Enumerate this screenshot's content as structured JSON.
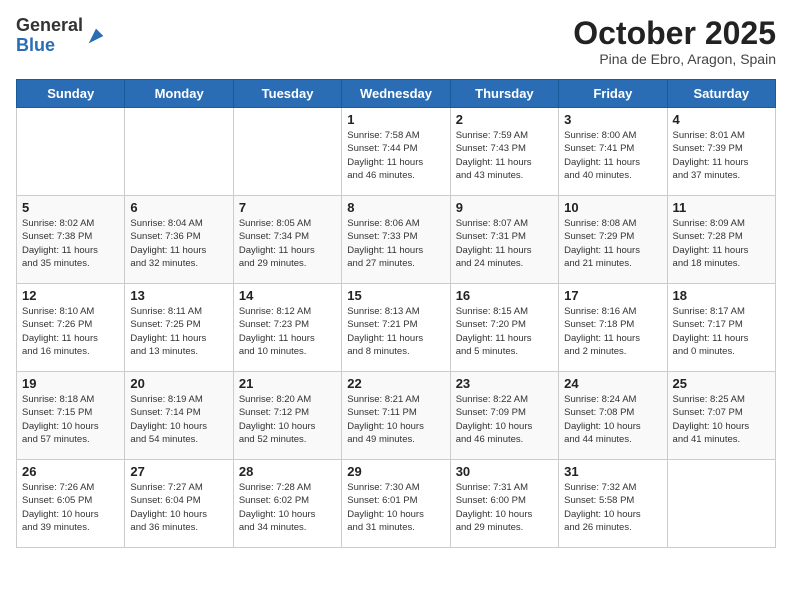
{
  "header": {
    "logo_line1": "General",
    "logo_line2": "Blue",
    "month": "October 2025",
    "location": "Pina de Ebro, Aragon, Spain"
  },
  "weekdays": [
    "Sunday",
    "Monday",
    "Tuesday",
    "Wednesday",
    "Thursday",
    "Friday",
    "Saturday"
  ],
  "weeks": [
    [
      {
        "day": "",
        "info": ""
      },
      {
        "day": "",
        "info": ""
      },
      {
        "day": "",
        "info": ""
      },
      {
        "day": "1",
        "info": "Sunrise: 7:58 AM\nSunset: 7:44 PM\nDaylight: 11 hours\nand 46 minutes."
      },
      {
        "day": "2",
        "info": "Sunrise: 7:59 AM\nSunset: 7:43 PM\nDaylight: 11 hours\nand 43 minutes."
      },
      {
        "day": "3",
        "info": "Sunrise: 8:00 AM\nSunset: 7:41 PM\nDaylight: 11 hours\nand 40 minutes."
      },
      {
        "day": "4",
        "info": "Sunrise: 8:01 AM\nSunset: 7:39 PM\nDaylight: 11 hours\nand 37 minutes."
      }
    ],
    [
      {
        "day": "5",
        "info": "Sunrise: 8:02 AM\nSunset: 7:38 PM\nDaylight: 11 hours\nand 35 minutes."
      },
      {
        "day": "6",
        "info": "Sunrise: 8:04 AM\nSunset: 7:36 PM\nDaylight: 11 hours\nand 32 minutes."
      },
      {
        "day": "7",
        "info": "Sunrise: 8:05 AM\nSunset: 7:34 PM\nDaylight: 11 hours\nand 29 minutes."
      },
      {
        "day": "8",
        "info": "Sunrise: 8:06 AM\nSunset: 7:33 PM\nDaylight: 11 hours\nand 27 minutes."
      },
      {
        "day": "9",
        "info": "Sunrise: 8:07 AM\nSunset: 7:31 PM\nDaylight: 11 hours\nand 24 minutes."
      },
      {
        "day": "10",
        "info": "Sunrise: 8:08 AM\nSunset: 7:29 PM\nDaylight: 11 hours\nand 21 minutes."
      },
      {
        "day": "11",
        "info": "Sunrise: 8:09 AM\nSunset: 7:28 PM\nDaylight: 11 hours\nand 18 minutes."
      }
    ],
    [
      {
        "day": "12",
        "info": "Sunrise: 8:10 AM\nSunset: 7:26 PM\nDaylight: 11 hours\nand 16 minutes."
      },
      {
        "day": "13",
        "info": "Sunrise: 8:11 AM\nSunset: 7:25 PM\nDaylight: 11 hours\nand 13 minutes."
      },
      {
        "day": "14",
        "info": "Sunrise: 8:12 AM\nSunset: 7:23 PM\nDaylight: 11 hours\nand 10 minutes."
      },
      {
        "day": "15",
        "info": "Sunrise: 8:13 AM\nSunset: 7:21 PM\nDaylight: 11 hours\nand 8 minutes."
      },
      {
        "day": "16",
        "info": "Sunrise: 8:15 AM\nSunset: 7:20 PM\nDaylight: 11 hours\nand 5 minutes."
      },
      {
        "day": "17",
        "info": "Sunrise: 8:16 AM\nSunset: 7:18 PM\nDaylight: 11 hours\nand 2 minutes."
      },
      {
        "day": "18",
        "info": "Sunrise: 8:17 AM\nSunset: 7:17 PM\nDaylight: 11 hours\nand 0 minutes."
      }
    ],
    [
      {
        "day": "19",
        "info": "Sunrise: 8:18 AM\nSunset: 7:15 PM\nDaylight: 10 hours\nand 57 minutes."
      },
      {
        "day": "20",
        "info": "Sunrise: 8:19 AM\nSunset: 7:14 PM\nDaylight: 10 hours\nand 54 minutes."
      },
      {
        "day": "21",
        "info": "Sunrise: 8:20 AM\nSunset: 7:12 PM\nDaylight: 10 hours\nand 52 minutes."
      },
      {
        "day": "22",
        "info": "Sunrise: 8:21 AM\nSunset: 7:11 PM\nDaylight: 10 hours\nand 49 minutes."
      },
      {
        "day": "23",
        "info": "Sunrise: 8:22 AM\nSunset: 7:09 PM\nDaylight: 10 hours\nand 46 minutes."
      },
      {
        "day": "24",
        "info": "Sunrise: 8:24 AM\nSunset: 7:08 PM\nDaylight: 10 hours\nand 44 minutes."
      },
      {
        "day": "25",
        "info": "Sunrise: 8:25 AM\nSunset: 7:07 PM\nDaylight: 10 hours\nand 41 minutes."
      }
    ],
    [
      {
        "day": "26",
        "info": "Sunrise: 7:26 AM\nSunset: 6:05 PM\nDaylight: 10 hours\nand 39 minutes."
      },
      {
        "day": "27",
        "info": "Sunrise: 7:27 AM\nSunset: 6:04 PM\nDaylight: 10 hours\nand 36 minutes."
      },
      {
        "day": "28",
        "info": "Sunrise: 7:28 AM\nSunset: 6:02 PM\nDaylight: 10 hours\nand 34 minutes."
      },
      {
        "day": "29",
        "info": "Sunrise: 7:30 AM\nSunset: 6:01 PM\nDaylight: 10 hours\nand 31 minutes."
      },
      {
        "day": "30",
        "info": "Sunrise: 7:31 AM\nSunset: 6:00 PM\nDaylight: 10 hours\nand 29 minutes."
      },
      {
        "day": "31",
        "info": "Sunrise: 7:32 AM\nSunset: 5:58 PM\nDaylight: 10 hours\nand 26 minutes."
      },
      {
        "day": "",
        "info": ""
      }
    ]
  ]
}
